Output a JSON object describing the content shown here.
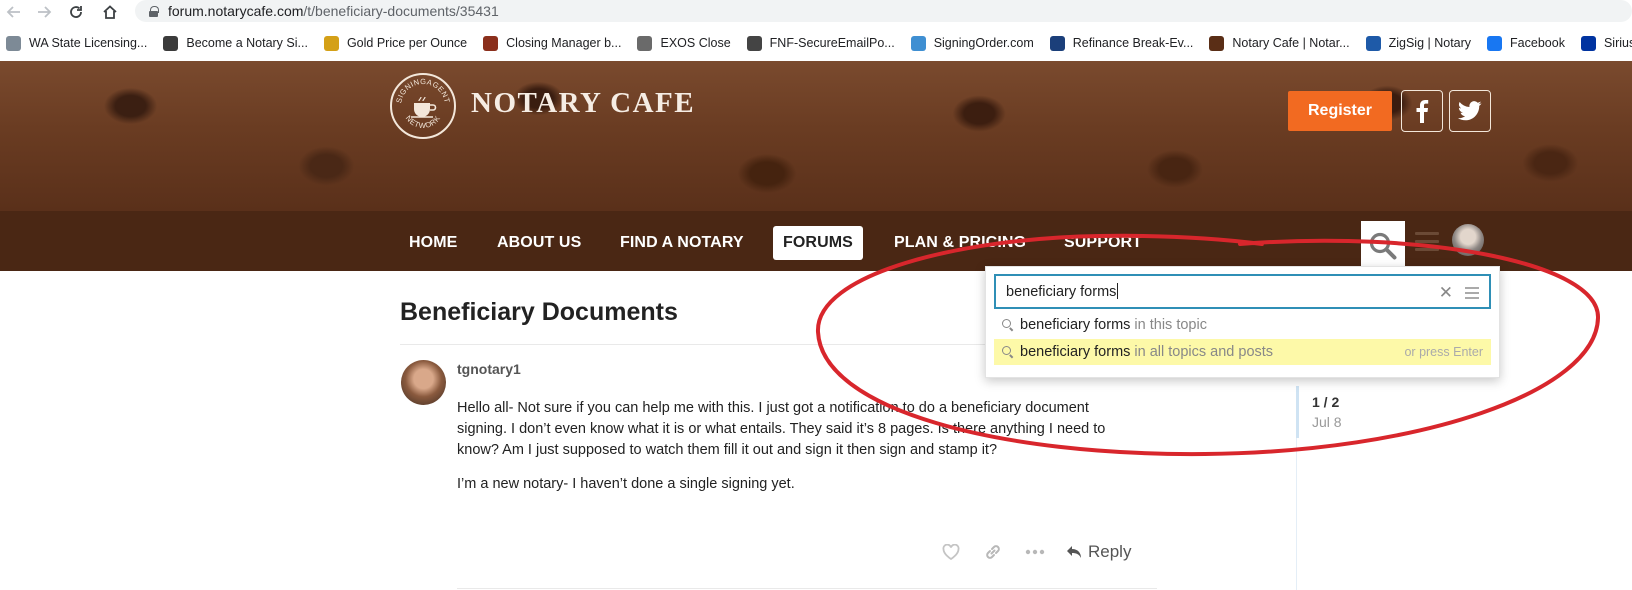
{
  "browser": {
    "url_host": "forum.notarycafe.com",
    "url_path": "/t/beneficiary-documents/35431",
    "back_icon": "arrow-left-icon",
    "forward_icon": "arrow-right-icon",
    "reload_icon": "reload-icon",
    "home_icon": "home-icon",
    "bookmarks": [
      {
        "label": "WA State Licensing...",
        "color": "#7d8a96"
      },
      {
        "label": "Become a Notary Si...",
        "color": "#3b3b3b"
      },
      {
        "label": "Gold Price per Ounce",
        "color": "#d4a017"
      },
      {
        "label": "Closing Manager b...",
        "color": "#8b2f1c"
      },
      {
        "label": "EXOS Close",
        "color": "#6a6a6a"
      },
      {
        "label": "FNF-SecureEmailPo...",
        "color": "#444444"
      },
      {
        "label": "SigningOrder.com",
        "color": "#3f8fd2"
      },
      {
        "label": "Refinance Break-Ev...",
        "color": "#1b3f7a"
      },
      {
        "label": "Notary Cafe | Notar...",
        "color": "#5a2e16"
      },
      {
        "label": "ZigSig | Notary",
        "color": "#1e5aa8"
      },
      {
        "label": "Facebook",
        "color": "#1877f2"
      },
      {
        "label": "SiriusXM - Search",
        "color": "#0033a0"
      }
    ]
  },
  "site": {
    "brand": "NOTARY CAFE",
    "seal_text": "SIGNINGAGENT NETWORK",
    "register_label": "Register",
    "accent_color": "#f26a21",
    "nav": [
      {
        "label": "HOME",
        "active": false
      },
      {
        "label": "ABOUT US",
        "active": false
      },
      {
        "label": "FIND A NOTARY",
        "active": false
      },
      {
        "label": "FORUMS",
        "active": true
      },
      {
        "label": "PLAN & PRICING",
        "active": false
      },
      {
        "label": "SUPPORT",
        "active": false
      }
    ]
  },
  "topic": {
    "title": "Beneficiary Documents",
    "post": {
      "author": "tgnotary1",
      "paragraphs": [
        "Hello all- Not sure if you can help me with this. I just got a notification to do a beneficiary document signing. I don’t even know what it is or what entails. They said it’s 8 pages. Is there anything I need to know? Am I just supposed to watch them fill it out and sign it then sign and stamp it?",
        "I’m a new notary- I haven’t done a single signing yet."
      ],
      "reply_label": "Reply"
    },
    "timeline": {
      "position": "1 / 2",
      "date": "Jul 8"
    }
  },
  "search": {
    "query": "beneficiary forms",
    "results": [
      {
        "term": "beneficiary forms",
        "scope": "in this topic",
        "highlighted": false,
        "hint": ""
      },
      {
        "term": "beneficiary forms",
        "scope": "in all topics and posts",
        "highlighted": true,
        "hint": "or press Enter"
      }
    ]
  },
  "annotation_color": "#d8262c"
}
